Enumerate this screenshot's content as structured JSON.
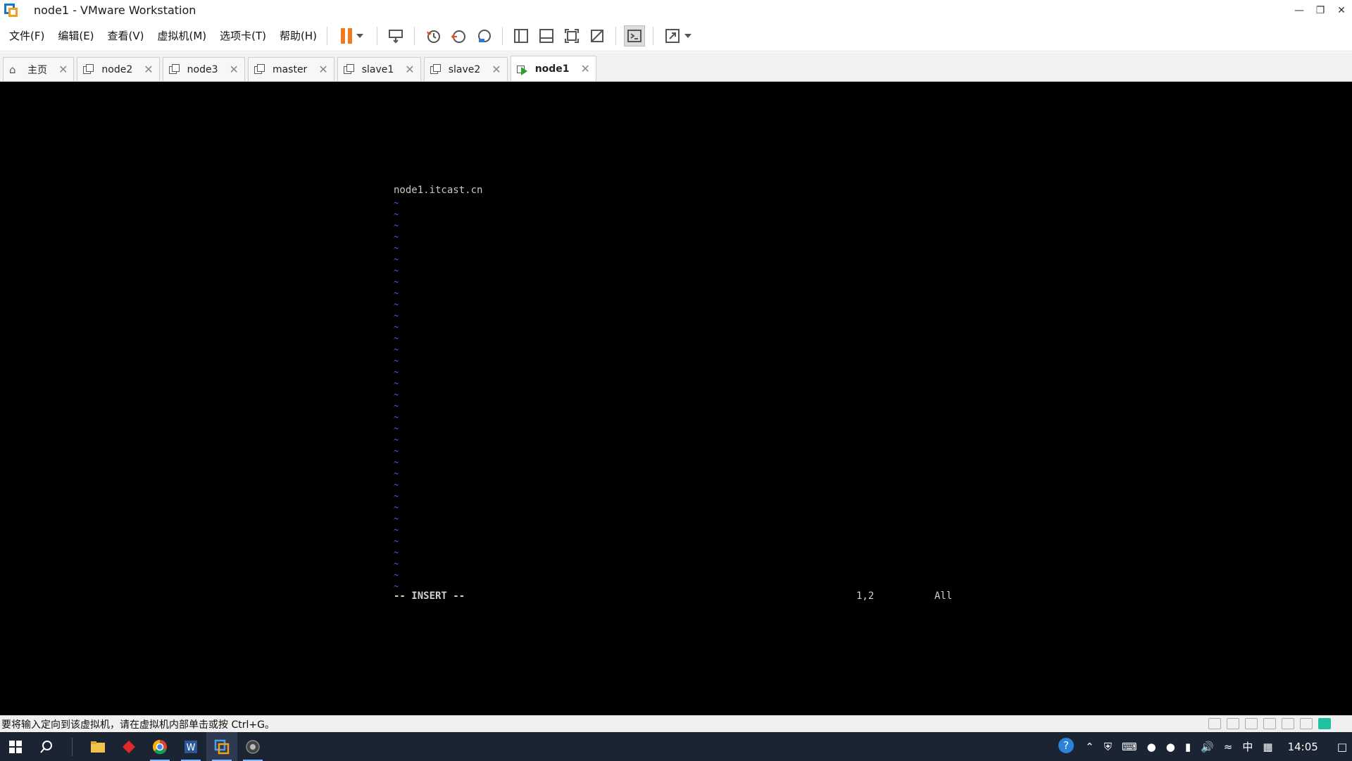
{
  "window": {
    "title": "node1 - VMware Workstation"
  },
  "menu": [
    {
      "label": "文件(F)"
    },
    {
      "label": "编辑(E)"
    },
    {
      "label": "查看(V)"
    },
    {
      "label": "虚拟机(M)"
    },
    {
      "label": "选项卡(T)"
    },
    {
      "label": "帮助(H)"
    }
  ],
  "tabs": [
    {
      "label": "主页",
      "icon": "home-icon",
      "active": false
    },
    {
      "label": "node2",
      "icon": "vm-icon",
      "active": false
    },
    {
      "label": "node3",
      "icon": "vm-icon",
      "active": false
    },
    {
      "label": "master",
      "icon": "vm-icon",
      "active": false
    },
    {
      "label": "slave1",
      "icon": "vm-icon",
      "active": false
    },
    {
      "label": "slave2",
      "icon": "vm-icon",
      "active": false
    },
    {
      "label": "node1",
      "icon": "vm-running-icon",
      "active": true
    }
  ],
  "terminal": {
    "first_line": "node1.itcast.cn",
    "tilde": "~",
    "mode": "-- INSERT --",
    "position": "1,2",
    "scroll": "All"
  },
  "statusbar": {
    "hint": "要将输入定向到该虚拟机，请在虚拟机内部单击或按 Ctrl+G。"
  },
  "taskbar": {
    "time": "14:05",
    "ime": "中"
  },
  "colors": {
    "accent_orange": "#f07a20",
    "vim_tilde": "#5a5aff",
    "taskbar_bg": "#1b2433"
  }
}
